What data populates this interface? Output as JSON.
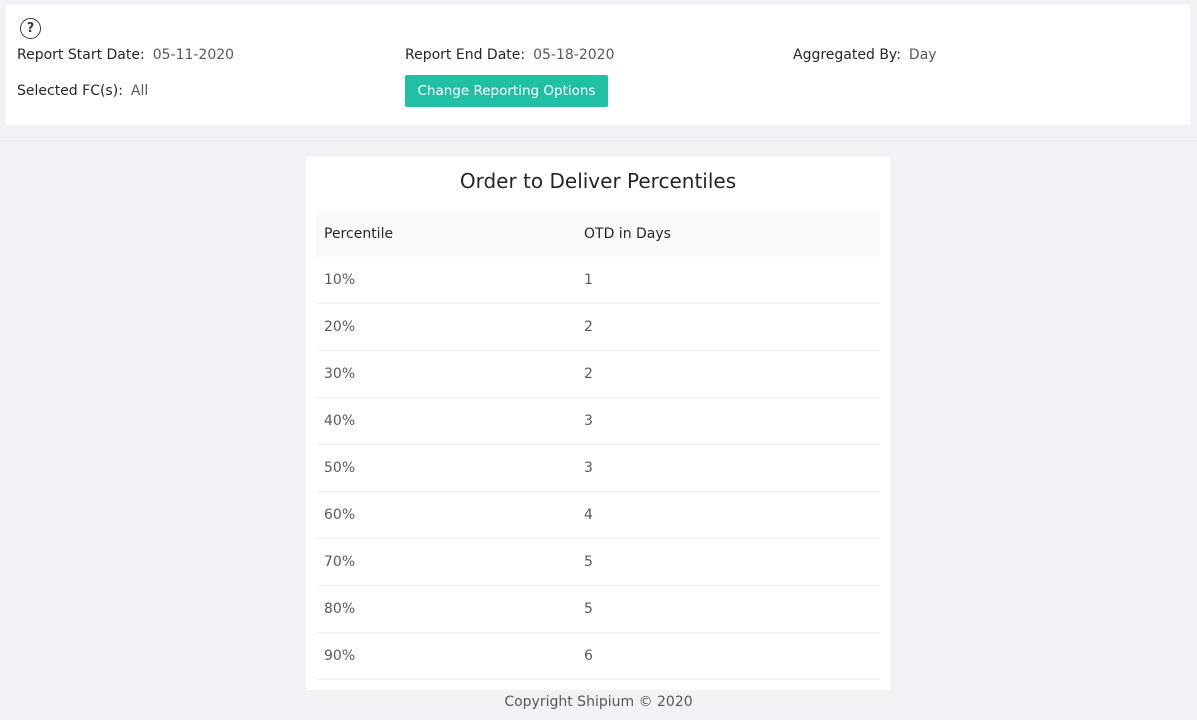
{
  "header": {
    "help_icon": "question-circle-icon",
    "start_date_label": "Report Start Date",
    "start_date_value": "05-11-2020",
    "end_date_label": "Report End Date",
    "end_date_value": "05-18-2020",
    "aggregated_label": "Aggregated By",
    "aggregated_value": "Day",
    "fc_label": "Selected FC(s)",
    "fc_value": "All",
    "change_button": "Change Reporting Options",
    "accent_color": "#20c0a4"
  },
  "table": {
    "title": "Order to Deliver Percentiles",
    "columns": [
      "Percentile",
      "OTD in Days"
    ],
    "rows": [
      [
        "10%",
        "1"
      ],
      [
        "20%",
        "2"
      ],
      [
        "30%",
        "2"
      ],
      [
        "40%",
        "3"
      ],
      [
        "50%",
        "3"
      ],
      [
        "60%",
        "4"
      ],
      [
        "70%",
        "5"
      ],
      [
        "80%",
        "5"
      ],
      [
        "90%",
        "6"
      ]
    ]
  },
  "footer": {
    "copyright": "Copyright Shipium © 2020"
  }
}
